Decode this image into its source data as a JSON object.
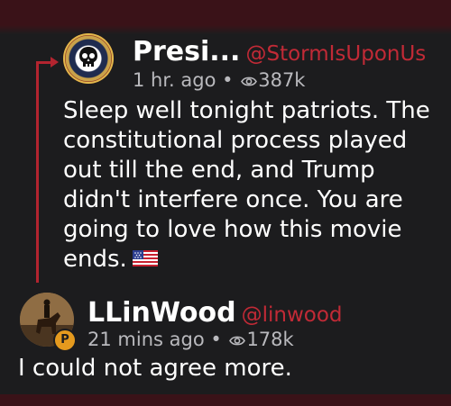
{
  "colors": {
    "background": "#1c1c1e",
    "bars": "#3a1218",
    "handle": "#c12a36",
    "thread_line": "#b3242f",
    "meta": "#b9b9bd",
    "badge": "#e59a1e"
  },
  "original_post": {
    "display_name": "Presi...",
    "handle": "@StormIsUponUs",
    "time": "1 hr. ago",
    "separator": "•",
    "views": "387k",
    "body": "Sleep well tonight patriots. The constitutional process played out till the end, and Trump didn't interfere once. You are going to love how this movie ends.",
    "avatar_icon": "skull-emblem-avatar",
    "flag_icon": "us-flag-emoji"
  },
  "reply": {
    "display_name": "LLinWood",
    "handle": "@linwood",
    "time": "21 mins ago",
    "separator": "•",
    "views": "178k",
    "body": "I could not agree more.",
    "avatar_icon": "photo-avatar",
    "badge_label": "P"
  }
}
